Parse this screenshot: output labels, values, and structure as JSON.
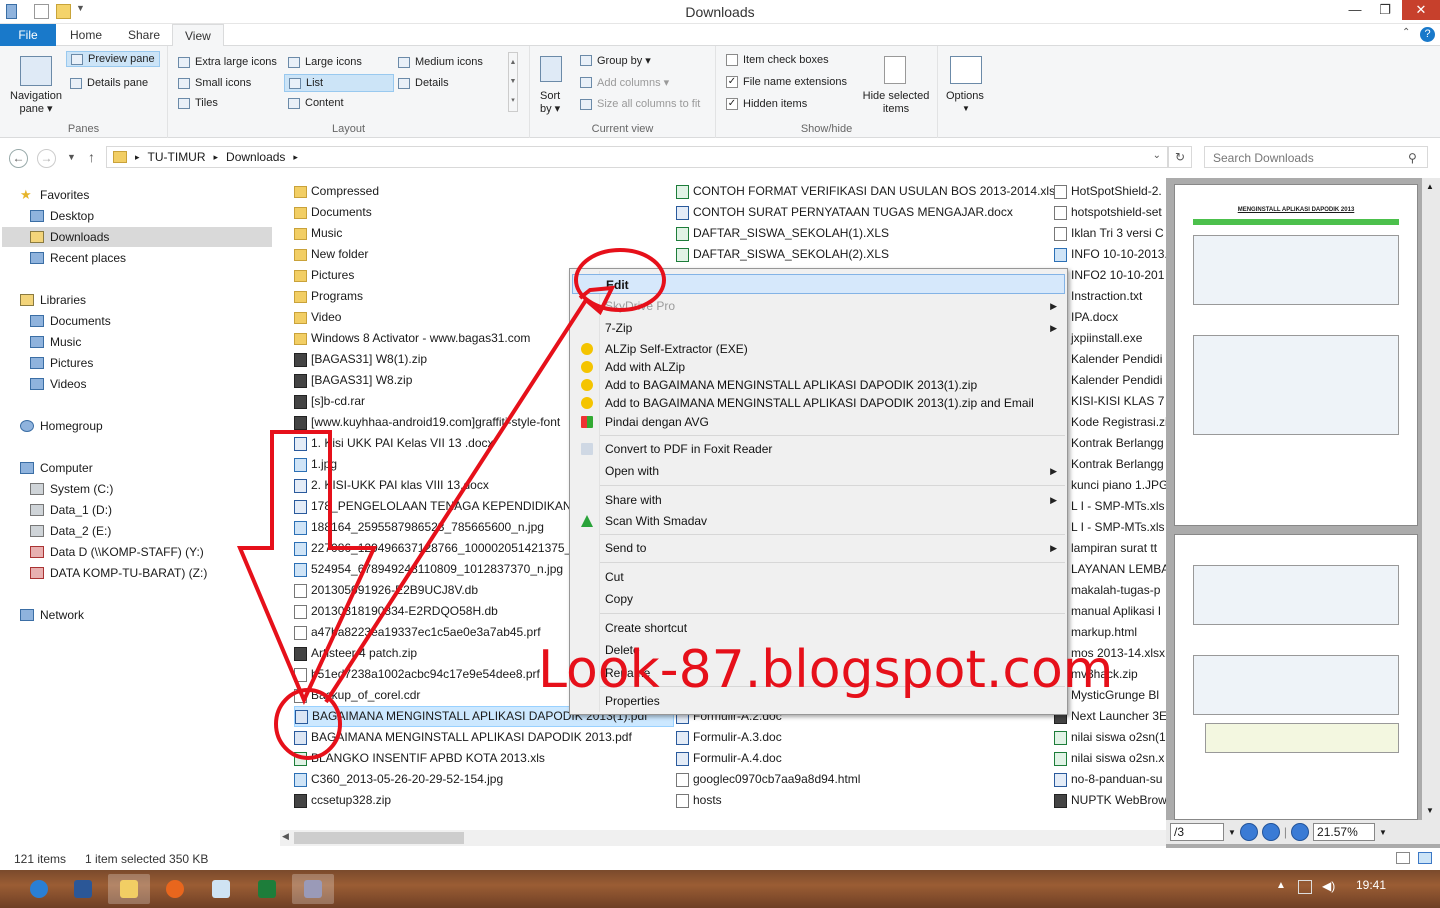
{
  "window": {
    "title": "Downloads",
    "min": "—",
    "max": "❐",
    "close": "✕"
  },
  "tabs": [
    "File",
    "Home",
    "Share",
    "View"
  ],
  "ribbon": {
    "panes": {
      "label": "Panes",
      "navigation_pane": "Navigation pane ▾",
      "preview_pane": "Preview pane",
      "details_pane": "Details pane"
    },
    "layout": {
      "label": "Layout",
      "items": [
        "Extra large icons",
        "Large icons",
        "Medium icons",
        "Small icons",
        "List",
        "Details",
        "Tiles",
        "Content"
      ]
    },
    "current_view": {
      "label": "Current view",
      "sort_by": "Sort by ▾",
      "group_by": "Group by ▾",
      "add_columns": "Add columns ▾",
      "size_all": "Size all columns to fit"
    },
    "show_hide": {
      "label": "Show/hide",
      "item_check_boxes": "Item check boxes",
      "file_name_extensions": "File name extensions",
      "hidden_items": "Hidden items",
      "hide_selected": "Hide selected items",
      "options": "Options"
    }
  },
  "address": {
    "path": [
      "TU-TIMUR",
      "Downloads"
    ],
    "search_placeholder": "Search Downloads"
  },
  "nav": {
    "favorites": "Favorites",
    "desktop": "Desktop",
    "downloads": "Downloads",
    "recent": "Recent places",
    "libraries": "Libraries",
    "documents": "Documents",
    "music": "Music",
    "pictures": "Pictures",
    "videos": "Videos",
    "homegroup": "Homegroup",
    "computer": "Computer",
    "drives": [
      "System (C:)",
      "Data_1 (D:)",
      "Data_2 (E:)",
      "Data D (\\\\KOMP-STAFF) (Y:)",
      "DATA KOMP-TU-BARAT) (Z:)"
    ],
    "network": "Network"
  },
  "files": {
    "col1": [
      {
        "name": "Compressed",
        "type": "folder"
      },
      {
        "name": "Documents",
        "type": "folder"
      },
      {
        "name": "Music",
        "type": "folder"
      },
      {
        "name": "New folder",
        "type": "folder"
      },
      {
        "name": "Pictures",
        "type": "folder"
      },
      {
        "name": "Programs",
        "type": "folder"
      },
      {
        "name": "Video",
        "type": "folder"
      },
      {
        "name": "Windows 8 Activator - www.bagas31.com",
        "type": "folder"
      },
      {
        "name": "[BAGAS31] W8(1).zip",
        "type": "zip"
      },
      {
        "name": "[BAGAS31] W8.zip",
        "type": "zip"
      },
      {
        "name": "[s]b-cd.rar",
        "type": "zip"
      },
      {
        "name": "[www.kuyhhaa-android19.com]graffiti-style-font",
        "type": "zip"
      },
      {
        "name": "1. Kisi  UKK PAI Kelas VII 13 .docx",
        "type": "doc"
      },
      {
        "name": "1.jpg",
        "type": "img"
      },
      {
        "name": "2. KISI-UKK PAI klas VIII 13.docx",
        "type": "doc"
      },
      {
        "name": "178_PENGELOLAAN TENAGA KEPENDIDIKAN-Ma",
        "type": "doc"
      },
      {
        "name": "188164_2595587986523_785665600_n.jpg",
        "type": "img"
      },
      {
        "name": "227086_129496637128766_100002051421375_2064",
        "type": "img"
      },
      {
        "name": "524954_678949248110809_1012837370_n.jpg",
        "type": "img"
      },
      {
        "name": "201305091926-E2B9UCJ8V.db",
        "type": "file"
      },
      {
        "name": "20130318190834-E2RDQO58H.db",
        "type": "file"
      },
      {
        "name": "a47ba8223ea19337ec1c5ae0e3a7ab45.prf",
        "type": "file"
      },
      {
        "name": "Artisteer 4 patch.zip",
        "type": "zip"
      },
      {
        "name": "b51ed7238a1002acbc94c17e9e54dee8.prf",
        "type": "file"
      },
      {
        "name": "Backup_of_corel.cdr",
        "type": "file"
      },
      {
        "name": "BAGAIMANA MENGINSTALL APLIKASI DAPODIK 2013(1).pdf",
        "type": "pdf"
      },
      {
        "name": "BAGAIMANA MENGINSTALL APLIKASI DAPODIK 2013.pdf",
        "type": "pdf"
      },
      {
        "name": "BLANGKO INSENTIF APBD KOTA 2013.xls",
        "type": "xls"
      },
      {
        "name": "C360_2013-05-26-20-29-52-154.jpg",
        "type": "img"
      },
      {
        "name": "ccsetup328.zip",
        "type": "zip"
      }
    ],
    "col2_top": [
      {
        "name": "CONTOH FORMAT VERIFIKASI DAN USULAN BOS 2013-2014.xlsx",
        "type": "xls"
      },
      {
        "name": "CONTOH SURAT PERNYATAAN TUGAS MENGAJAR.docx",
        "type": "doc"
      },
      {
        "name": "DAFTAR_SISWA_SEKOLAH(1).XLS",
        "type": "xls"
      },
      {
        "name": "DAFTAR_SISWA_SEKOLAH(2).XLS",
        "type": "xls"
      }
    ],
    "col2_bottom": [
      {
        "name": "Formulir-A.2.doc",
        "type": "doc"
      },
      {
        "name": "Formulir-A.3.doc",
        "type": "doc"
      },
      {
        "name": "Formulir-A.4.doc",
        "type": "doc"
      },
      {
        "name": "googlec0970cb7aa9a8d94.html",
        "type": "file"
      },
      {
        "name": "hosts",
        "type": "file"
      }
    ],
    "col3": [
      {
        "name": "HotSpotShield-2.",
        "type": "file"
      },
      {
        "name": "hotspotshield-set",
        "type": "file"
      },
      {
        "name": "Iklan Tri 3 versi C",
        "type": "file"
      },
      {
        "name": "INFO 10-10-2013.",
        "type": "img"
      },
      {
        "name": "INFO2 10-10-201",
        "type": "img"
      },
      {
        "name": "Instraction.txt",
        "type": "file"
      },
      {
        "name": "IPA.docx",
        "type": "doc"
      },
      {
        "name": "jxpiinstall.exe",
        "type": "file"
      },
      {
        "name": "Kalender Pendidi",
        "type": "xls"
      },
      {
        "name": "Kalender Pendidi",
        "type": "xls"
      },
      {
        "name": "KISI-KISI KLAS 7  I",
        "type": "doc"
      },
      {
        "name": "Kode Registrasi.zi",
        "type": "zip"
      },
      {
        "name": "Kontrak Berlangg",
        "type": "doc"
      },
      {
        "name": "Kontrak Berlangg",
        "type": "doc"
      },
      {
        "name": "kunci piano 1.JPG",
        "type": "img"
      },
      {
        "name": "L I - SMP-MTs.xls",
        "type": "xls"
      },
      {
        "name": "L I - SMP-MTs.xls",
        "type": "xls"
      },
      {
        "name": "lampiran surat tt",
        "type": "doc"
      },
      {
        "name": "LAYANAN LEMBA",
        "type": "doc"
      },
      {
        "name": "makalah-tugas-p",
        "type": "doc"
      },
      {
        "name": "manual Aplikasi I",
        "type": "pdf"
      },
      {
        "name": "markup.html",
        "type": "file"
      },
      {
        "name": "mos 2013-14.xlsx",
        "type": "xls"
      },
      {
        "name": "mv3hack.zip",
        "type": "zip"
      },
      {
        "name": "MysticGrunge Bl",
        "type": "file"
      },
      {
        "name": "Next Launcher 3E",
        "type": "zip"
      },
      {
        "name": "nilai siswa o2sn(1",
        "type": "xls"
      },
      {
        "name": "nilai siswa o2sn.x",
        "type": "xls"
      },
      {
        "name": "no-8-panduan-su",
        "type": "doc"
      },
      {
        "name": "NUPTK WebBrow",
        "type": "zip"
      }
    ]
  },
  "context_menu": {
    "edit": "Edit",
    "skydrive": "SkyDrive Pro",
    "sevenzip": "7-Zip",
    "alzip_sfx": "ALZip Self-Extractor (EXE)",
    "add_alzip": "Add with ALZip",
    "add_to": "Add to BAGAIMANA MENGINSTALL APLIKASI DAPODIK 2013(1).zip",
    "add_to_email": "Add to BAGAIMANA MENGINSTALL APLIKASI DAPODIK 2013(1).zip and Email",
    "avg": "Pindai dengan AVG",
    "foxit": "Convert to PDF in Foxit Reader",
    "open_with": "Open with",
    "share_with": "Share with",
    "smadav": "Scan With Smadav",
    "send_to": "Send to",
    "cut": "Cut",
    "copy": "Copy",
    "create_shortcut": "Create shortcut",
    "delete": "Delete",
    "rename": "Rename",
    "properties": "Properties",
    "submenu_arrow": "▶"
  },
  "preview": {
    "heading": "MENGINSTALL APLIKASI DAPODIK 2013",
    "page_field": "/3",
    "zoom": "21.57%"
  },
  "status": {
    "count": "121 items",
    "selected": "1 item selected  350 KB"
  },
  "taskbar": {
    "clock": "19:41"
  },
  "watermark": "Look-87.blogspot.com",
  "colors": {
    "accent": "#1979ca",
    "annotation_red": "#e6101a",
    "selection": "#cce8ff"
  }
}
